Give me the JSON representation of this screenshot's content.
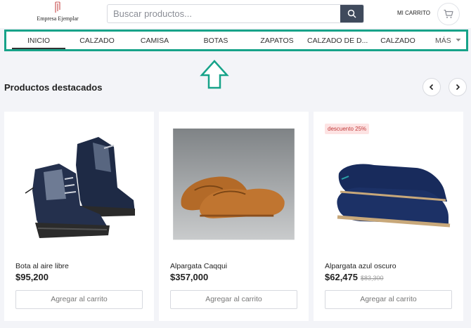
{
  "brand": {
    "name": "Empresa Ejemplar"
  },
  "search": {
    "placeholder": "Buscar productos..."
  },
  "header": {
    "cart_label": "MI CARRITO"
  },
  "nav": {
    "items": [
      "INICIO",
      "CALZADO",
      "CAMISA",
      "BOTAS",
      "ZAPATOS",
      "CALZADO DE D...",
      "CALZADO"
    ],
    "active": "INICIO",
    "more_label": "MÁS"
  },
  "section": {
    "title": "Productos destacados"
  },
  "products": [
    {
      "name": "Bota al aire libre",
      "price": "$95,200",
      "old_price": "",
      "badge": "",
      "button": "Agregar al carrito"
    },
    {
      "name": "Alpargata Caqqui",
      "price": "$357,000",
      "old_price": "",
      "badge": "",
      "button": "Agregar al carrito"
    },
    {
      "name": "Alpargata azul oscuro",
      "price": "$62,475",
      "old_price": "$83,300",
      "badge": "descuento 25%",
      "button": "Agregar al carrito"
    }
  ],
  "colors": {
    "accent": "#17a389",
    "search_button": "#3f4a5c",
    "badge_bg": "#fde3e3",
    "badge_text": "#c03838"
  },
  "icons": {
    "search": "search-icon",
    "cart": "cart-icon",
    "prev": "chevron-left-icon",
    "next": "chevron-right-icon",
    "annotation": "up-arrow-icon"
  }
}
